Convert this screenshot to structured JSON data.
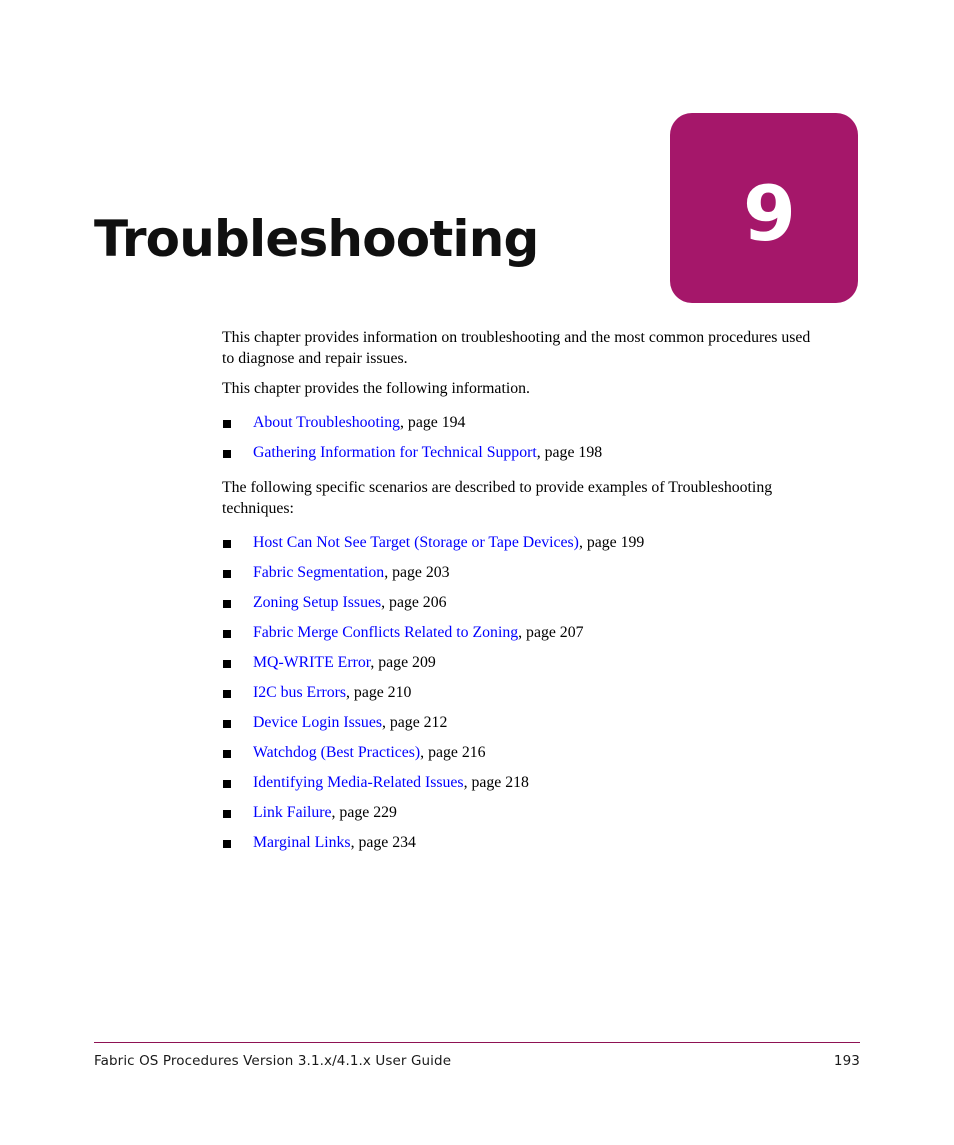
{
  "page": {
    "background_color": "#ffffff",
    "accent_color": "#a5176a",
    "link_color": "#0000ff",
    "rule_color": "#8e1254"
  },
  "chapter": {
    "number": "9",
    "title": "Troubleshooting"
  },
  "intro": {
    "paragraph_1": "This chapter provides information on troubleshooting and the most common procedures used to diagnose and repair issues.",
    "paragraph_2": "This chapter provides the following information.",
    "paragraph_3": "The following specific scenarios are described to provide examples of Troubleshooting techniques:"
  },
  "overview_list": [
    {
      "link": "About Troubleshooting",
      "page_ref": ", page 194"
    },
    {
      "link": "Gathering Information for Technical Support",
      "page_ref": ", page 198"
    }
  ],
  "scenario_list": [
    {
      "link": "Host Can Not See Target (Storage or Tape Devices)",
      "page_ref": ", page 199"
    },
    {
      "link": "Fabric Segmentation",
      "page_ref": ", page 203"
    },
    {
      "link": "Zoning Setup Issues",
      "page_ref": ", page 206"
    },
    {
      "link": "Fabric Merge Conflicts Related to Zoning",
      "page_ref": ", page 207"
    },
    {
      "link": "MQ-WRITE Error",
      "page_ref": ", page 209"
    },
    {
      "link": "I2C bus Errors",
      "page_ref": ", page 210"
    },
    {
      "link": "Device Login Issues",
      "page_ref": ", page 212"
    },
    {
      "link": "Watchdog (Best Practices)",
      "page_ref": ", page 216"
    },
    {
      "link": "Identifying Media-Related Issues",
      "page_ref": ", page 218"
    },
    {
      "link": "Link Failure",
      "page_ref": ", page 229"
    },
    {
      "link": "Marginal Links",
      "page_ref": ", page 234"
    }
  ],
  "footer": {
    "document_title": "Fabric OS Procedures Version 3.1.x/4.1.x User Guide",
    "page_number": "193"
  }
}
